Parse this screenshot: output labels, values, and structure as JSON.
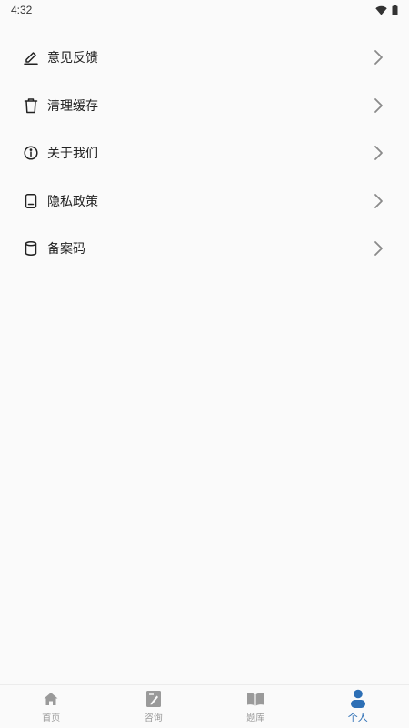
{
  "status_bar": {
    "time": "4:32"
  },
  "menu": {
    "items": [
      {
        "label": "意见反馈",
        "icon": "edit-icon"
      },
      {
        "label": "清理缓存",
        "icon": "trash-icon"
      },
      {
        "label": "关于我们",
        "icon": "info-icon"
      },
      {
        "label": "隐私政策",
        "icon": "document-icon"
      },
      {
        "label": "备案码",
        "icon": "database-icon"
      }
    ]
  },
  "bottom_nav": {
    "items": [
      {
        "label": "首页",
        "icon": "home-icon",
        "active": false
      },
      {
        "label": "咨询",
        "icon": "edit-note-icon",
        "active": false
      },
      {
        "label": "题库",
        "icon": "book-icon",
        "active": false
      },
      {
        "label": "个人",
        "icon": "person-icon",
        "active": true
      }
    ]
  },
  "colors": {
    "accent": "#2d6fb5",
    "inactive": "#9a9a9a",
    "background": "#fafafa"
  }
}
